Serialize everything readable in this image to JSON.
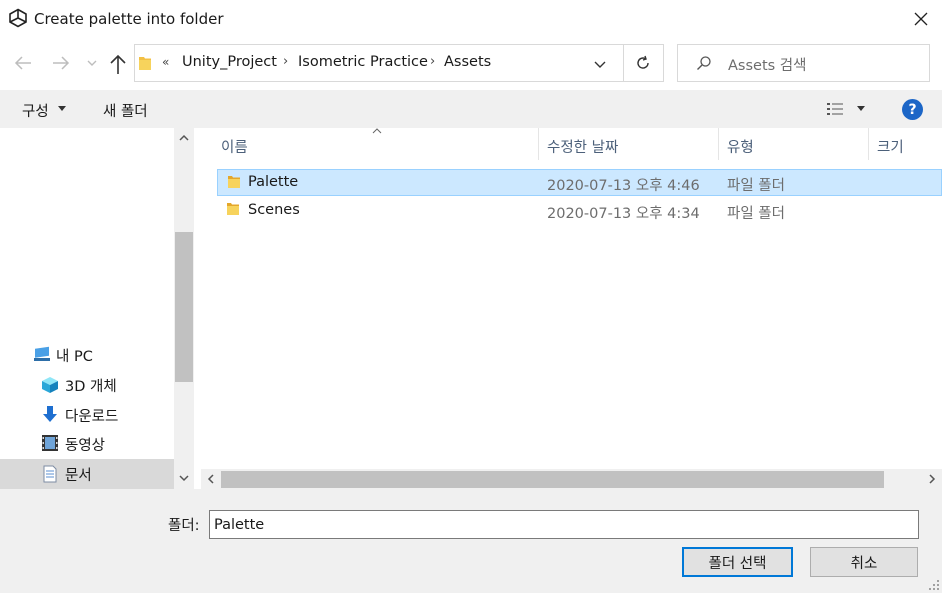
{
  "window": {
    "title": "Create palette into folder",
    "icon": "unity-icon",
    "close_icon": "close-icon"
  },
  "address": {
    "overflow_chevron": "«",
    "breadcrumbs": [
      "Unity_Project",
      "Isometric Practice",
      "Assets"
    ],
    "separator": "›"
  },
  "search": {
    "placeholder": "Assets 검색"
  },
  "toolbar": {
    "organize_label": "구성",
    "new_folder_label": "새 폴더",
    "help_label": "?"
  },
  "nav": {
    "items": [
      {
        "label": "내 PC",
        "icon": "computer-icon"
      },
      {
        "label": "3D 개체",
        "icon": "cube-icon"
      },
      {
        "label": "다운로드",
        "icon": "download-arrow-icon"
      },
      {
        "label": "동영상",
        "icon": "video-icon"
      },
      {
        "label": "문서",
        "icon": "document-icon",
        "selected": true
      }
    ]
  },
  "columns": {
    "name": "이름",
    "date": "수정한 날짜",
    "type": "유형",
    "size": "크기"
  },
  "files": [
    {
      "name": "Palette",
      "date": "2020-07-13 오후 4:46",
      "type": "파일 폴더",
      "selected": true
    },
    {
      "name": "Scenes",
      "date": "2020-07-13 오후 4:34",
      "type": "파일 폴더",
      "selected": false
    }
  ],
  "footer": {
    "folder_label": "폴더:",
    "folder_value": "Palette",
    "select_label": "폴더 선택",
    "cancel_label": "취소"
  },
  "colors": {
    "accent": "#0078d7",
    "selection": "#cce8ff",
    "folder": "#f3c044",
    "help": "#1c66c7"
  }
}
